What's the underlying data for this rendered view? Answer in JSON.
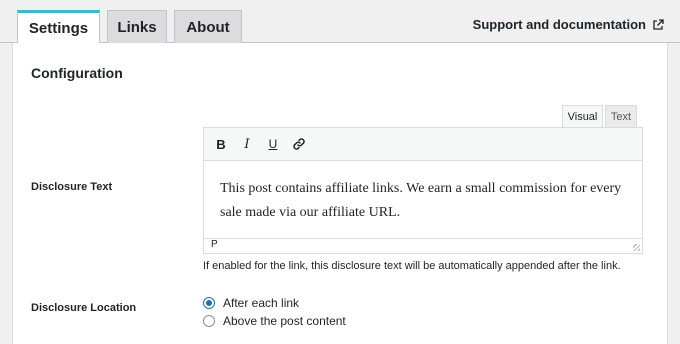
{
  "tabs": {
    "settings": "Settings",
    "links": "Links",
    "about": "About"
  },
  "support_link": "Support and documentation",
  "section_title": "Configuration",
  "editor": {
    "visual_tab": "Visual",
    "text_tab": "Text",
    "toolbar": {
      "bold": "B",
      "italic": "I",
      "underline": "U"
    },
    "content": "This post contains affiliate links. We earn a small commission for every sale made via our affiliate URL.",
    "status_path": "P"
  },
  "fields": {
    "disclosure_text_label": "Disclosure Text",
    "disclosure_text_help": "If enabled for the link, this disclosure text will be automatically appended after the link.",
    "disclosure_location_label": "Disclosure Location",
    "location_options": [
      {
        "label": "After each link",
        "checked": true
      },
      {
        "label": "Above the post content",
        "checked": false
      }
    ]
  },
  "colors": {
    "accent": "#3db8c9",
    "radio": "#2271b1"
  }
}
